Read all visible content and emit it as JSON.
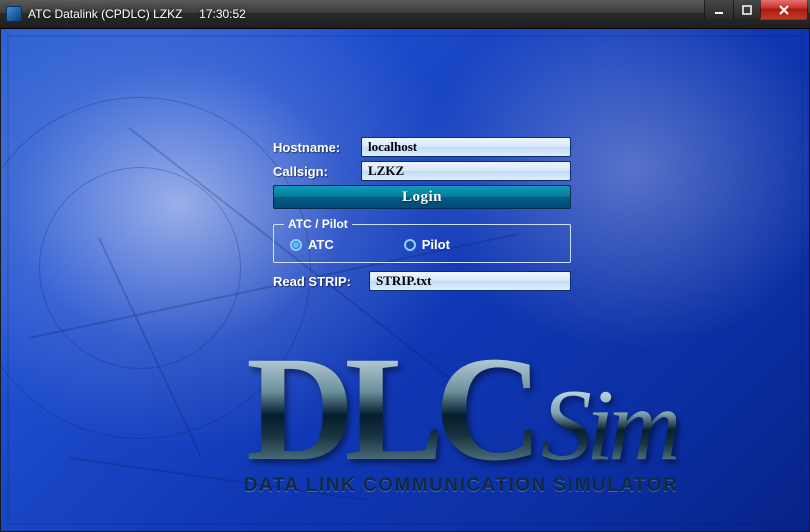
{
  "window": {
    "title": "ATC Datalink (CPDLC) LZKZ     17:30:52"
  },
  "form": {
    "hostname_label": "Hostname:",
    "hostname_value": "localhost",
    "callsign_label": "Callsign:",
    "callsign_value": "LZKZ",
    "login_label": "Login",
    "role_legend": "ATC / Pilot",
    "role_options": {
      "atc": "ATC",
      "pilot": "Pilot"
    },
    "role_selected": "atc",
    "strip_label": "Read STRIP:",
    "strip_value": "STRIP.txt"
  },
  "branding": {
    "logo_main": "DLC",
    "logo_suffix": "Sim",
    "subtitle": "DATA LINK COMMUNICATION SIMULATOR"
  }
}
